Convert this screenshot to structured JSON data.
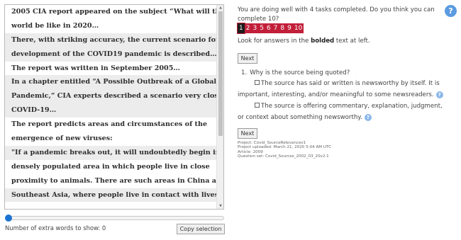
{
  "article": {
    "lines": [
      {
        "text": "2005 CIA report appeared on the subject “What will the",
        "shaded": false
      },
      {
        "text": "world be like in 2020…",
        "shaded": false
      },
      {
        "text": "There, with striking accuracy, the current scenario for the",
        "shaded": true
      },
      {
        "text": "development of the COVID19 pandemic is described…",
        "shaded": true
      },
      {
        "text": "The report was written in September 2005…",
        "shaded": false
      },
      {
        "text": "In a chapter entitled “A Possible Outbreak of a Global",
        "shaded": true
      },
      {
        "text": "Pandemic,” CIA experts described a scenario very close to",
        "shaded": true
      },
      {
        "text": "COVID-19…",
        "shaded": true
      },
      {
        "text": "The report predicts areas and circumstances of the",
        "shaded": false
      },
      {
        "text": "emergence of new viruses:",
        "shaded": false
      },
      {
        "text": "\"If a pandemic breaks out, it will undoubtedly begin in a",
        "shaded": true
      },
      {
        "text": "densely populated area in which people live in close",
        "shaded": false
      },
      {
        "text": "proximity to animals. There are such areas in China and",
        "shaded": false
      },
      {
        "text": "Southeast Asia, where people live in contact with livestock…",
        "shaded": true
      }
    ],
    "scroll_up_glyph": "▲",
    "scroll_down_glyph": "▼"
  },
  "extra_words": {
    "label": "Number of extra words to show: 0",
    "value": 0,
    "fill_fraction": 0.0
  },
  "copy_button_label": "Copy selection",
  "progress_text": "You are doing well with 4 tasks completed. Do you think you can complete 10?",
  "help_glyph": "?",
  "tasks": {
    "numbers": [
      "1",
      "2",
      "3",
      "5",
      "6",
      "7",
      "8",
      "9",
      "10"
    ],
    "current": "1",
    "colors": {
      "bar": "#c21f3a",
      "current": "#1c1c1c"
    }
  },
  "instructions": {
    "before": "Look for answers in the ",
    "bold": "bolded",
    "after": " text at left."
  },
  "next_label": "Next",
  "question": {
    "number": "1.",
    "text": "Why is the source being quoted?",
    "options": [
      {
        "text": "The source has said or written is newsworthy by itself. It is important, interesting, and/or meaningful to some newsreaders.",
        "checked": false
      },
      {
        "text": "The source is offering commentary, explanation, judgment, or context about something newsworthy.",
        "checked": false
      }
    ]
  },
  "meta": {
    "project": "Project: Covid_SourceRelevancev1",
    "uploaded": "Project uploaded: March 21, 2020 5:04 AM UTC",
    "article": "Article: 2009",
    "question_set": "Question set: Covid_Sources_2002_03_20v2.1"
  }
}
